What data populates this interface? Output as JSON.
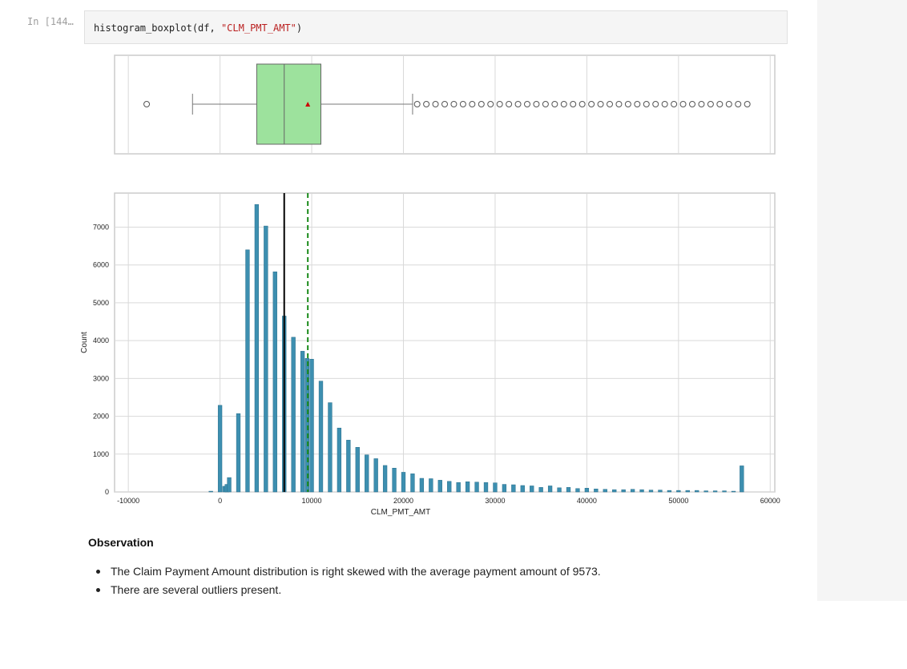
{
  "cell": {
    "prompt": "In [144…",
    "code": {
      "func": "histogram_boxplot",
      "open": "(df, ",
      "arg": "\"CLM_PMT_AMT\"",
      "close": ")"
    }
  },
  "colors": {
    "box_fill": "#9de29d",
    "hist_bar": "#3d8fb0",
    "median_line": "#000000",
    "mean_line": "#1a8a1a",
    "mean_marker": "#cc0000",
    "grid": "#d9d9d9"
  },
  "chart_data": [
    {
      "type": "boxplot",
      "xlim": [
        -11500,
        60500
      ],
      "grid": true,
      "min_outlier": -8000,
      "whisker_low": -3000,
      "q1": 4000,
      "median": 7000,
      "mean": 9573,
      "q3": 11000,
      "whisker_high": 21000,
      "outliers": [
        21500,
        22500,
        23500,
        24500,
        25500,
        26500,
        27500,
        28500,
        29500,
        30500,
        31500,
        32500,
        33500,
        34500,
        35500,
        36500,
        37500,
        38500,
        39500,
        40500,
        41500,
        42500,
        43500,
        44500,
        45500,
        46500,
        47500,
        48500,
        49500,
        50500,
        51500,
        52500,
        53500,
        54500,
        55500,
        56500,
        57500
      ]
    },
    {
      "type": "bar",
      "xlabel": "CLM_PMT_AMT",
      "ylabel": "Count",
      "xlim": [
        -11500,
        60500
      ],
      "ylim": [
        0,
        7900
      ],
      "grid": true,
      "xticks": [
        "-10000",
        "0",
        "10000",
        "20000",
        "30000",
        "40000",
        "50000",
        "60000"
      ],
      "xtick_values": [
        -10000,
        0,
        10000,
        20000,
        30000,
        40000,
        50000,
        60000
      ],
      "yticks": [
        "0",
        "1000",
        "2000",
        "3000",
        "4000",
        "5000",
        "6000",
        "7000"
      ],
      "ytick_values": [
        0,
        1000,
        2000,
        3000,
        4000,
        5000,
        6000,
        7000
      ],
      "x": [
        -1000,
        0,
        500,
        750,
        1000,
        2000,
        3000,
        4000,
        5000,
        6000,
        7000,
        8000,
        9000,
        9500,
        10000,
        11000,
        12000,
        13000,
        14000,
        15000,
        16000,
        17000,
        18000,
        19000,
        20000,
        21000,
        22000,
        23000,
        24000,
        25000,
        26000,
        27000,
        28000,
        29000,
        30000,
        31000,
        32000,
        33000,
        34000,
        35000,
        36000,
        37000,
        38000,
        39000,
        40000,
        41000,
        42000,
        43000,
        44000,
        45000,
        46000,
        47000,
        48000,
        49000,
        50000,
        51000,
        52000,
        53000,
        54000,
        55000,
        56000,
        56900
      ],
      "values": [
        20,
        2290,
        150,
        200,
        380,
        2070,
        6400,
        7600,
        7030,
        5820,
        4650,
        4090,
        3720,
        3530,
        3510,
        2930,
        2360,
        1690,
        1370,
        1180,
        980,
        880,
        700,
        630,
        520,
        480,
        360,
        350,
        310,
        280,
        250,
        270,
        260,
        250,
        240,
        200,
        190,
        170,
        160,
        120,
        160,
        110,
        120,
        90,
        100,
        80,
        70,
        60,
        60,
        70,
        60,
        50,
        50,
        40,
        40,
        40,
        40,
        30,
        30,
        30,
        20,
        690
      ],
      "bin_width": 420,
      "median": 7000,
      "mean": 9573
    }
  ],
  "observation": {
    "title": "Observation",
    "items": [
      "The Claim Payment Amount distribution is right skewed with the average payment amount of 9573.",
      "There are several outliers present."
    ]
  }
}
